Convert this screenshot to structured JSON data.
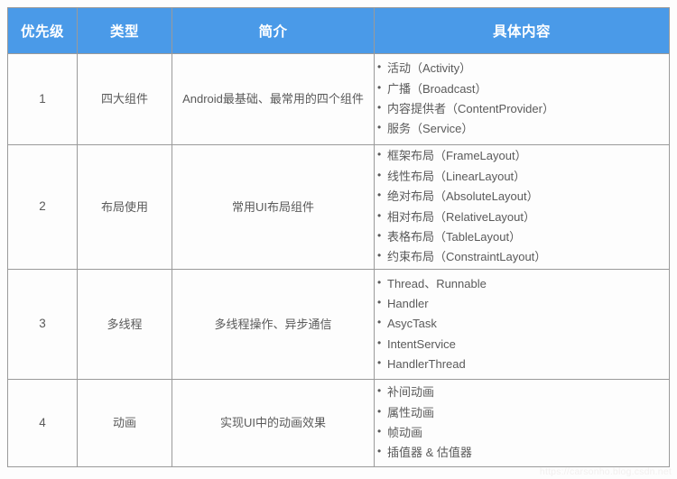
{
  "table": {
    "headers": [
      "优先级",
      "类型",
      "简介",
      "具体内容"
    ],
    "rows": [
      {
        "priority": "1",
        "type": "四大组件",
        "intro": "Android最基础、最常用的四个组件",
        "details": [
          "活动（Activity）",
          "广播（Broadcast）",
          "内容提供者（ContentProvider）",
          "服务（Service）"
        ]
      },
      {
        "priority": "2",
        "type": "布局使用",
        "intro": "常用UI布局组件",
        "details": [
          "框架布局（FrameLayout）",
          "线性布局（LinearLayout）",
          "绝对布局（AbsoluteLayout）",
          "相对布局（RelativeLayout）",
          "表格布局（TableLayout）",
          "约束布局（ConstraintLayout）"
        ]
      },
      {
        "priority": "3",
        "type": "多线程",
        "intro": "多线程操作、异步通信",
        "details": [
          "Thread、Runnable",
          "Handler",
          "AsycTask",
          "IntentService",
          "HandlerThread"
        ]
      },
      {
        "priority": "4",
        "type": "动画",
        "intro": "实现UI中的动画效果",
        "details": [
          "补间动画",
          "属性动画",
          "帧动画",
          "插值器 & 估值器"
        ]
      }
    ]
  },
  "watermark": {
    "text": "https://carsonho.blog.csdn.net"
  },
  "colors": {
    "header_background": "#4a9ae8",
    "header_text": "#ffffff",
    "body_text": "#5a5a5a",
    "border": "#9a9a9a",
    "page_background": "#fdfdfd"
  }
}
